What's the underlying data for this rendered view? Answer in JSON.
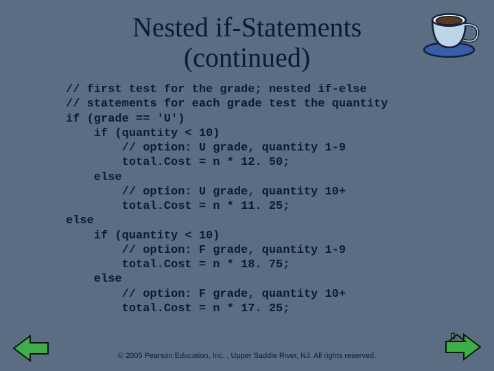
{
  "title_line1": "Nested if-Statements",
  "title_line2": "(continued)",
  "code_lines": [
    "// first test for the grade; nested if-else",
    "// statements for each grade test the quantity",
    "if (grade == 'U')",
    "    if (quantity < 10)",
    "        // option: U grade, quantity 1-9",
    "        total.Cost = n * 12. 50;",
    "    else",
    "        // option: U grade, quantity 10+",
    "        total.Cost = n * 11. 25;",
    "else",
    "    if (quantity < 10)",
    "        // option: F grade, quantity 1-9",
    "        total.Cost = n * 18. 75;",
    "    else",
    "        // option: F grade, quantity 10+",
    "        total.Cost = n * 17. 25;"
  ],
  "footer": "© 2005 Pearson Education, Inc. , Upper Saddle River, NJ.  All rights reserved.",
  "icons": {
    "cup": "coffee-cup-icon",
    "prev": "prev-arrow-icon",
    "next": "next-house-icon"
  },
  "colors": {
    "bg": "#5a6d82",
    "text": "#0a1a3a",
    "arrow": "#3fae49",
    "arrow_outline": "#0b1a0b",
    "cup_body": "#bcd6e8",
    "cup_rim": "#ffffff",
    "cup_coffee": "#5a3a1a",
    "cup_outline": "#17203a",
    "saucer": "#3a5da8"
  }
}
